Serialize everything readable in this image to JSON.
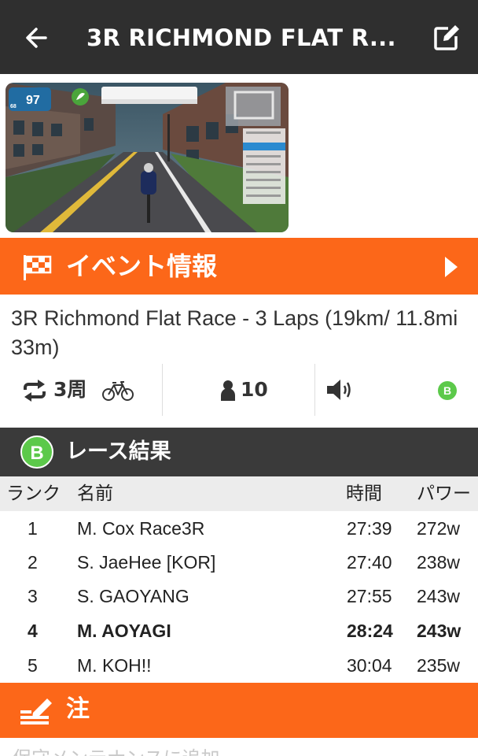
{
  "header": {
    "title": "3R RICHMOND FLAT R...",
    "back_icon": "arrow-left-icon",
    "edit_icon": "edit-icon",
    "background": "#2f2f2f"
  },
  "thumbnail": {
    "hud_power": "97",
    "hud_unit": "w",
    "hud_hr": "68"
  },
  "event_info": {
    "label": "イベント情報",
    "accent": "#fc6719",
    "icon": "checkered-flag-icon",
    "chevron": "play-arrow-icon"
  },
  "event": {
    "name": "3R Richmond Flat Race - 3 Laps (19km/ 11.8mi 33m)",
    "laps": "3周",
    "riders": "10",
    "category": "B",
    "category_color": "#5cc94a"
  },
  "results": {
    "badge": "B",
    "label": "レース結果",
    "columns": [
      "ランク",
      "名前",
      "時間",
      "パワー"
    ],
    "rows": [
      {
        "rank": "1",
        "name": "M. Cox Race3R",
        "time": "27:39",
        "power": "272w"
      },
      {
        "rank": "2",
        "name": "S. JaeHee [KOR]",
        "time": "27:40",
        "power": "238w"
      },
      {
        "rank": "3",
        "name": "S. GAOYANG",
        "time": "27:55",
        "power": "243w"
      },
      {
        "rank": "4",
        "name": "M. AOYAGI",
        "time": "28:24",
        "power": "243w"
      },
      {
        "rank": "5",
        "name": "M. KOH!!",
        "time": "30:04",
        "power": "235w"
      }
    ]
  },
  "notes": {
    "label": "注",
    "icon": "pencil-icon",
    "cut_text": "保守メンテナンスに追加"
  }
}
